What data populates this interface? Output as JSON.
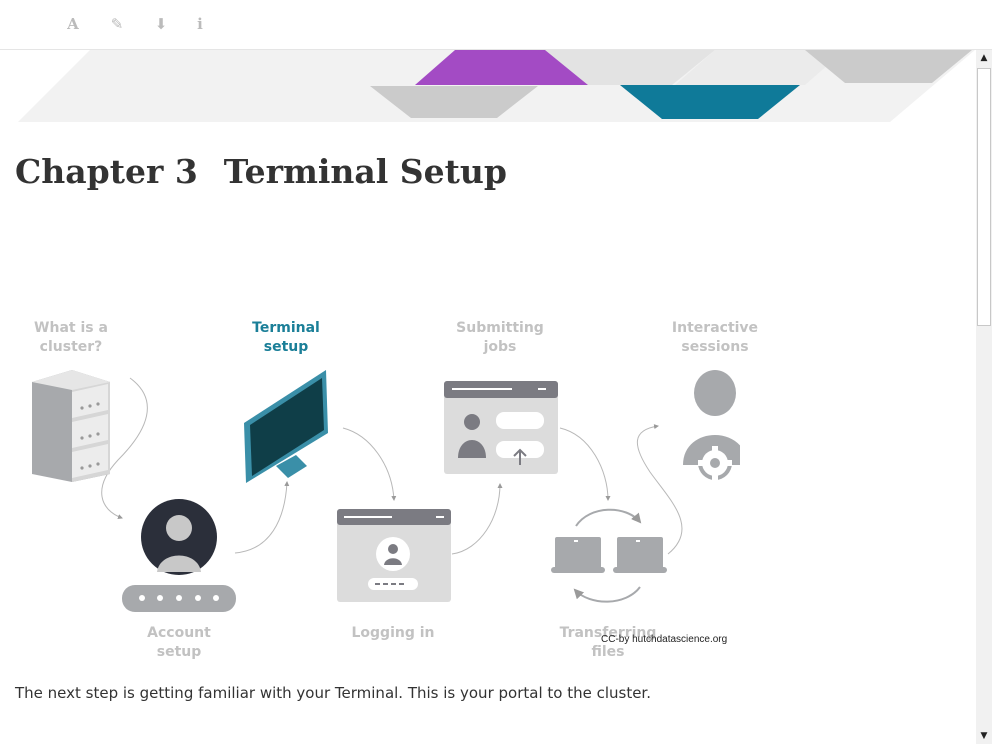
{
  "toolbar": {
    "font_icon": "A",
    "edit_icon": "✎",
    "download_icon": "⬇",
    "info_icon": "i"
  },
  "chapter": {
    "number": "Chapter 3",
    "title": "Terminal Setup"
  },
  "figure": {
    "steps": [
      {
        "label": "What is a\ncluster?",
        "active": false
      },
      {
        "label": "Account\nsetup",
        "active": false
      },
      {
        "label": "Terminal\nsetup",
        "active": true
      },
      {
        "label": "Logging in",
        "active": false
      },
      {
        "label": "Submitting\njobs",
        "active": false
      },
      {
        "label": "Transferring\nfiles",
        "active": false
      },
      {
        "label": "Interactive\nsessions",
        "active": false
      }
    ],
    "credit": "CC-by hutchdatascience.org",
    "colors": {
      "active": "#1b7f98",
      "inactive": "#c2c2c2",
      "icon_grey": "#a7a9ac",
      "banner_purple": "#a34bc4",
      "banner_teal": "#0f7a99"
    }
  },
  "paragraph": "The next step is getting familiar with your Terminal. This is your portal to the cluster.",
  "scrollbar": {
    "up_arrow": "▲",
    "down_arrow": "▼"
  }
}
